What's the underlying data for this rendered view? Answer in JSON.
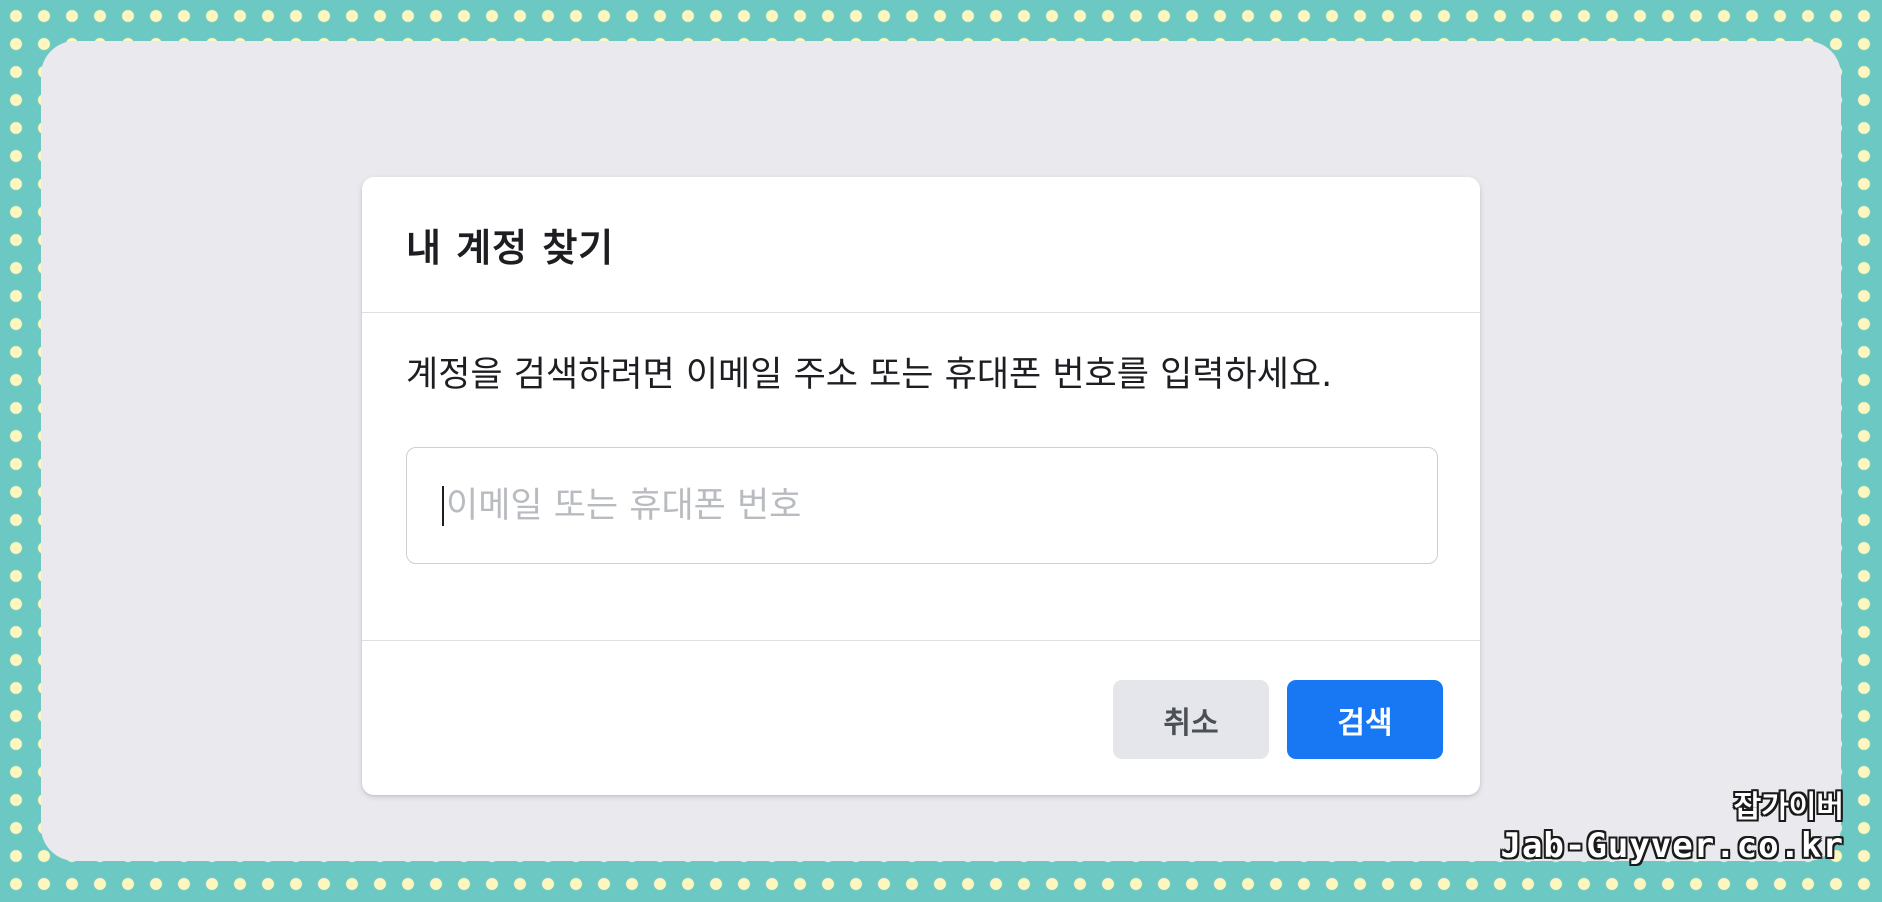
{
  "dialog": {
    "title": "내 계정 찾기",
    "instruction": "계정을 검색하려면 이메일 주소 또는 휴대폰 번호를 입력하세요.",
    "search_input": {
      "placeholder": "이메일 또는 휴대폰 번호",
      "value": ""
    },
    "cancel_label": "취소",
    "search_label": "검색"
  },
  "watermark": {
    "korean": "잡가이버",
    "domain": "Jab-Guyver.co.kr"
  },
  "colors": {
    "background_teal": "#6cc8c3",
    "dots": "#fdf6bf",
    "frame": "#e9e9ee",
    "primary_button": "#1877f2",
    "secondary_button": "#e4e6eb"
  }
}
